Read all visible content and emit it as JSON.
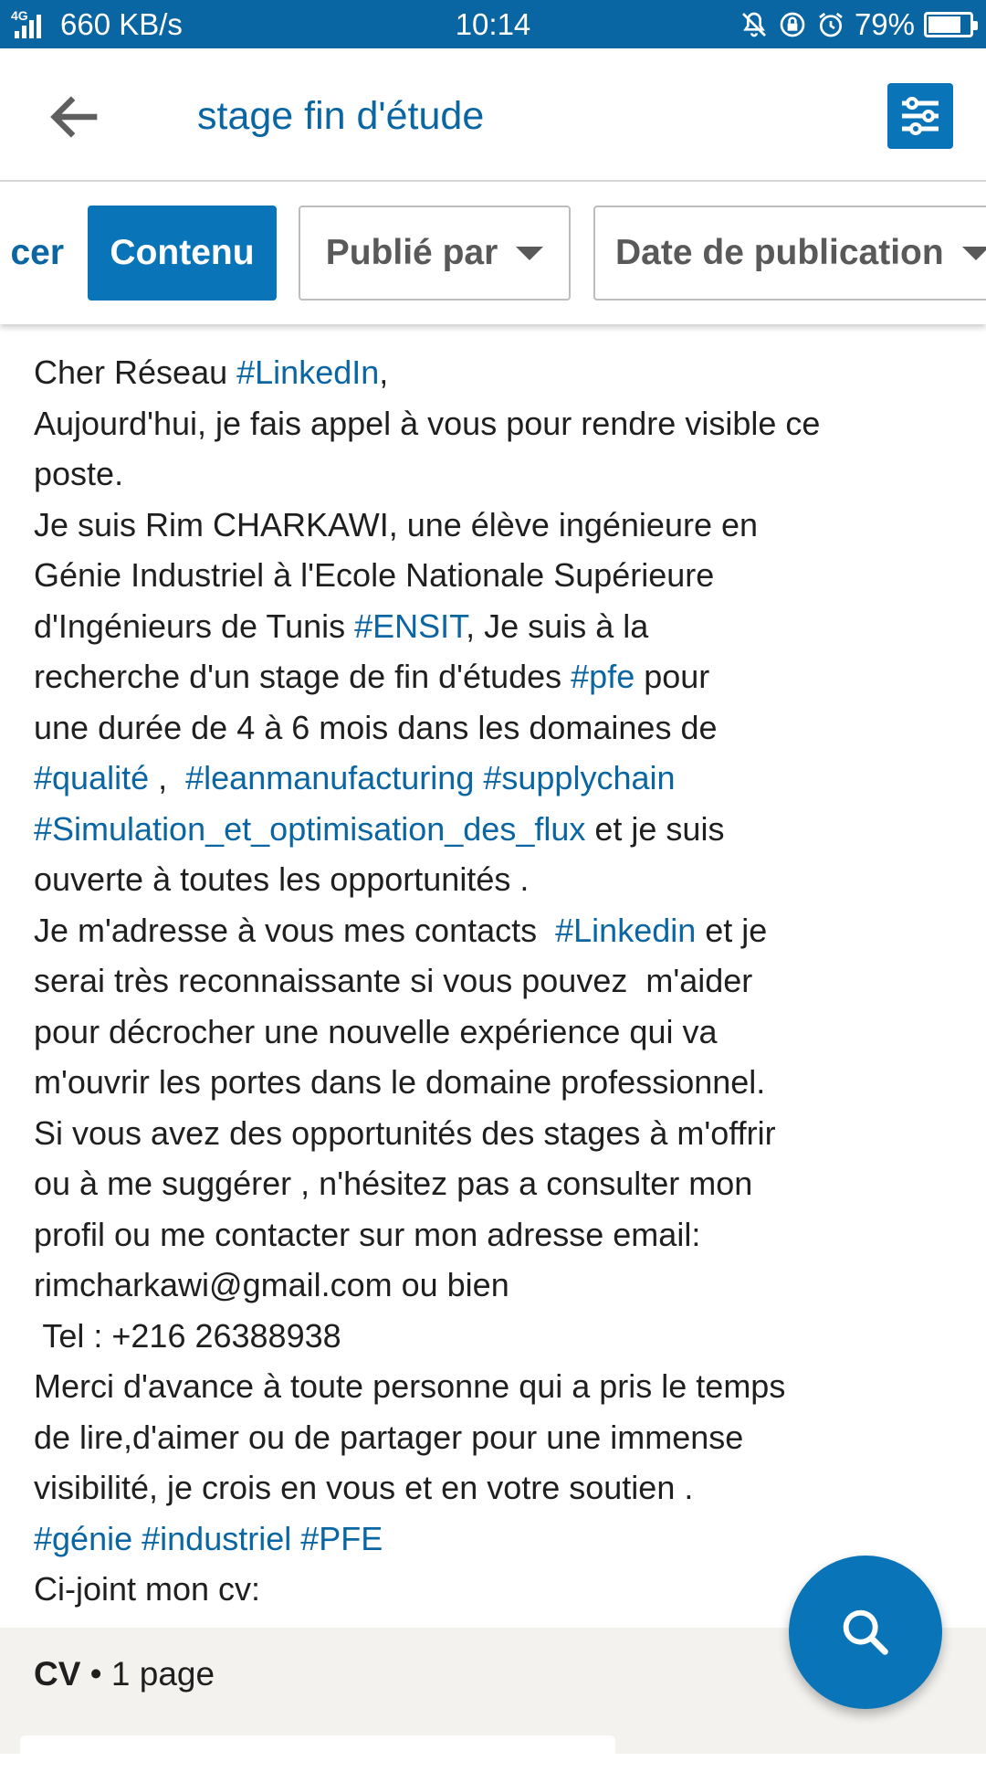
{
  "status_bar": {
    "network": "4G",
    "speed": "660 KB/s",
    "time": "10:14",
    "battery": "79%",
    "battery_level": 0.79
  },
  "header": {
    "search_query": "stage fin d'étude"
  },
  "filters": [
    {
      "label": "cer"
    },
    {
      "label": "Contenu"
    },
    {
      "label": "Publié par"
    },
    {
      "label": "Date de publication"
    }
  ],
  "post": {
    "lines": [
      [
        {
          "t": "Cher Réseau "
        },
        {
          "t": "#LinkedIn",
          "tag": true
        },
        {
          "t": ","
        }
      ],
      [
        {
          "t": "Aujourd'hui, je fais appel à vous pour rendre visible ce"
        }
      ],
      [
        {
          "t": "poste."
        }
      ],
      [
        {
          "t": "Je suis Rim CHARKAWI, une élève ingénieure en"
        }
      ],
      [
        {
          "t": "Génie Industriel à l'Ecole Nationale Supérieure"
        }
      ],
      [
        {
          "t": "d'Ingénieurs de Tunis "
        },
        {
          "t": "#ENSIT",
          "tag": true
        },
        {
          "t": ", Je suis à la"
        }
      ],
      [
        {
          "t": "recherche d'un stage de fin d'études "
        },
        {
          "t": "#pfe",
          "tag": true
        },
        {
          "t": " pour"
        }
      ],
      [
        {
          "t": "une durée de 4 à 6 mois dans les domaines de"
        }
      ],
      [
        {
          "t": "#qualité",
          "tag": true
        },
        {
          "t": " ,  "
        },
        {
          "t": "#leanmanufacturing",
          "tag": true
        },
        {
          "t": " "
        },
        {
          "t": "#supplychain",
          "tag": true
        }
      ],
      [
        {
          "t": "#Simulation_et_optimisation_des_flux",
          "tag": true
        },
        {
          "t": " et je suis"
        }
      ],
      [
        {
          "t": "ouverte à toutes les opportunités ."
        }
      ],
      [
        {
          "t": "Je m'adresse à vous mes contacts  "
        },
        {
          "t": "#Linkedin",
          "tag": true
        },
        {
          "t": " et je"
        }
      ],
      [
        {
          "t": "serai très reconnaissante si vous pouvez  m'aider"
        }
      ],
      [
        {
          "t": "pour décrocher une nouvelle expérience qui va"
        }
      ],
      [
        {
          "t": "m'ouvrir les portes dans le domaine professionnel."
        }
      ],
      [
        {
          "t": "Si vous avez des opportunités des stages à m'offrir"
        }
      ],
      [
        {
          "t": "ou à me suggérer , n'hésitez pas a consulter mon"
        }
      ],
      [
        {
          "t": "profil ou me contacter sur mon adresse email:"
        }
      ],
      [
        {
          "t": "rimcharkawi@gmail.com ou bien"
        }
      ],
      [
        {
          "t": " Tel : +216 26388938"
        }
      ],
      [
        {
          "t": "Merci d'avance à toute personne qui a pris le temps"
        }
      ],
      [
        {
          "t": "de lire,d'aimer ou de partager pour une immense"
        }
      ],
      [
        {
          "t": "visibilité, je crois en vous et en votre soutien ."
        }
      ],
      [
        {
          "t": "#génie",
          "tag": true
        },
        {
          "t": " "
        },
        {
          "t": "#industriel",
          "tag": true
        },
        {
          "t": " "
        },
        {
          "t": "#PFE",
          "tag": true
        }
      ],
      [
        {
          "t": "Ci-joint mon cv:"
        }
      ]
    ]
  },
  "attachment": {
    "name": "CV",
    "separator": " • ",
    "pages": "1 page"
  },
  "icons": {
    "back": "arrow-left-icon",
    "filter": "sliders-icon",
    "fab": "search-icon"
  },
  "colors": {
    "accent": "#0a74b8",
    "link": "#0a66a3",
    "status_bar": "#0a66a3"
  }
}
